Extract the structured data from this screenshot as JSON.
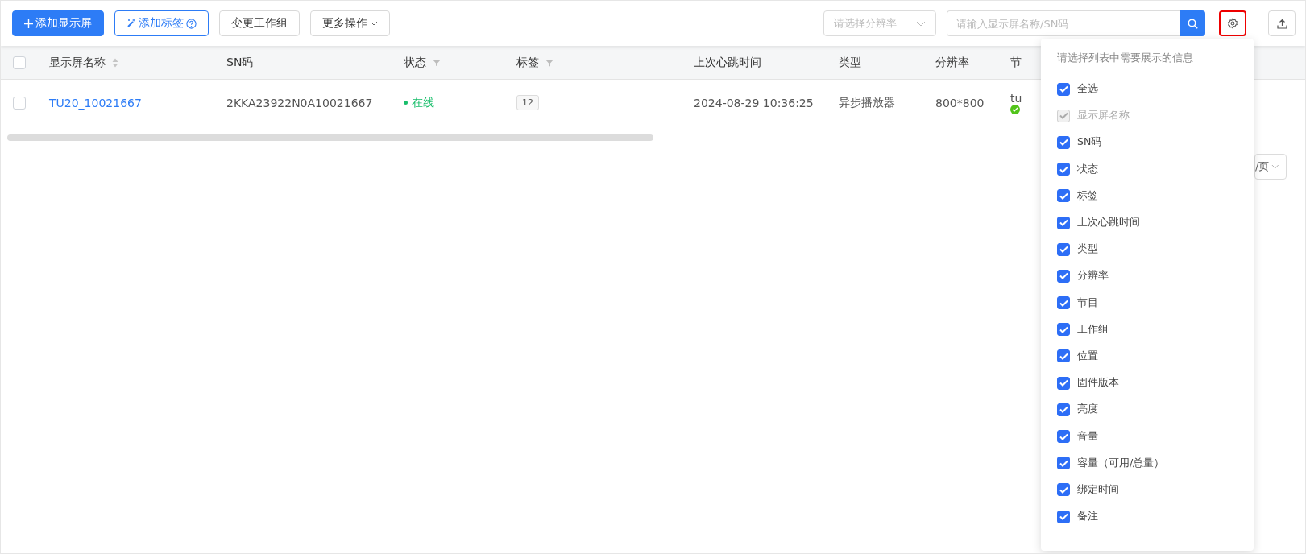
{
  "toolbar": {
    "buttons": [
      {
        "kind": "primary",
        "label": "添加显示屏"
      },
      {
        "kind": "outline",
        "label": "添加标签",
        "help": true
      },
      {
        "kind": "default",
        "label": "变更工作组"
      },
      {
        "kind": "dropdown",
        "label": "更多操作"
      }
    ],
    "resolution_select": {
      "placeholder": "请选择分辨率"
    },
    "search": {
      "placeholder": "请输入显示屏名称/SN码"
    }
  },
  "table": {
    "all_checked": false,
    "columns": [
      {
        "label": "显示屏名称",
        "sort": true
      },
      {
        "label": "SN码"
      },
      {
        "label": "状态",
        "filter": true
      },
      {
        "label": "标签",
        "filter": true
      },
      {
        "label": "上次心跳时间"
      },
      {
        "label": "类型"
      },
      {
        "label": "分辨率"
      },
      {
        "label": "节"
      }
    ],
    "rows": [
      {
        "checked": false,
        "name": "TU20_10021667",
        "sn": "2KKA23922N0A10021667",
        "status": "在线",
        "online": true,
        "tag": "12",
        "heartbeat": "2024-08-29 10:36:25",
        "type": "异步播放器",
        "resolution": "800*800",
        "program": "tu"
      }
    ]
  },
  "pagination": {
    "page_size": "/页"
  },
  "column_settings": {
    "title": "请选择列表中需要展示的信息",
    "items": [
      {
        "label": "全选",
        "checked": true,
        "disabled": false
      },
      {
        "label": "显示屏名称",
        "checked": true,
        "disabled": true
      },
      {
        "label": "SN码",
        "checked": true,
        "disabled": false
      },
      {
        "label": "状态",
        "checked": true,
        "disabled": false
      },
      {
        "label": "标签",
        "checked": true,
        "disabled": false
      },
      {
        "label": "上次心跳时间",
        "checked": true,
        "disabled": false
      },
      {
        "label": "类型",
        "checked": true,
        "disabled": false
      },
      {
        "label": "分辨率",
        "checked": true,
        "disabled": false
      },
      {
        "label": "节目",
        "checked": true,
        "disabled": false
      },
      {
        "label": "工作组",
        "checked": true,
        "disabled": false
      },
      {
        "label": "位置",
        "checked": true,
        "disabled": false
      },
      {
        "label": "固件版本",
        "checked": true,
        "disabled": false
      },
      {
        "label": "亮度",
        "checked": true,
        "disabled": false
      },
      {
        "label": "音量",
        "checked": true,
        "disabled": false
      },
      {
        "label": "容量（可用/总量）",
        "checked": true,
        "disabled": false
      },
      {
        "label": "绑定时间",
        "checked": true,
        "disabled": false
      },
      {
        "label": "备注",
        "checked": true,
        "disabled": false
      }
    ]
  }
}
